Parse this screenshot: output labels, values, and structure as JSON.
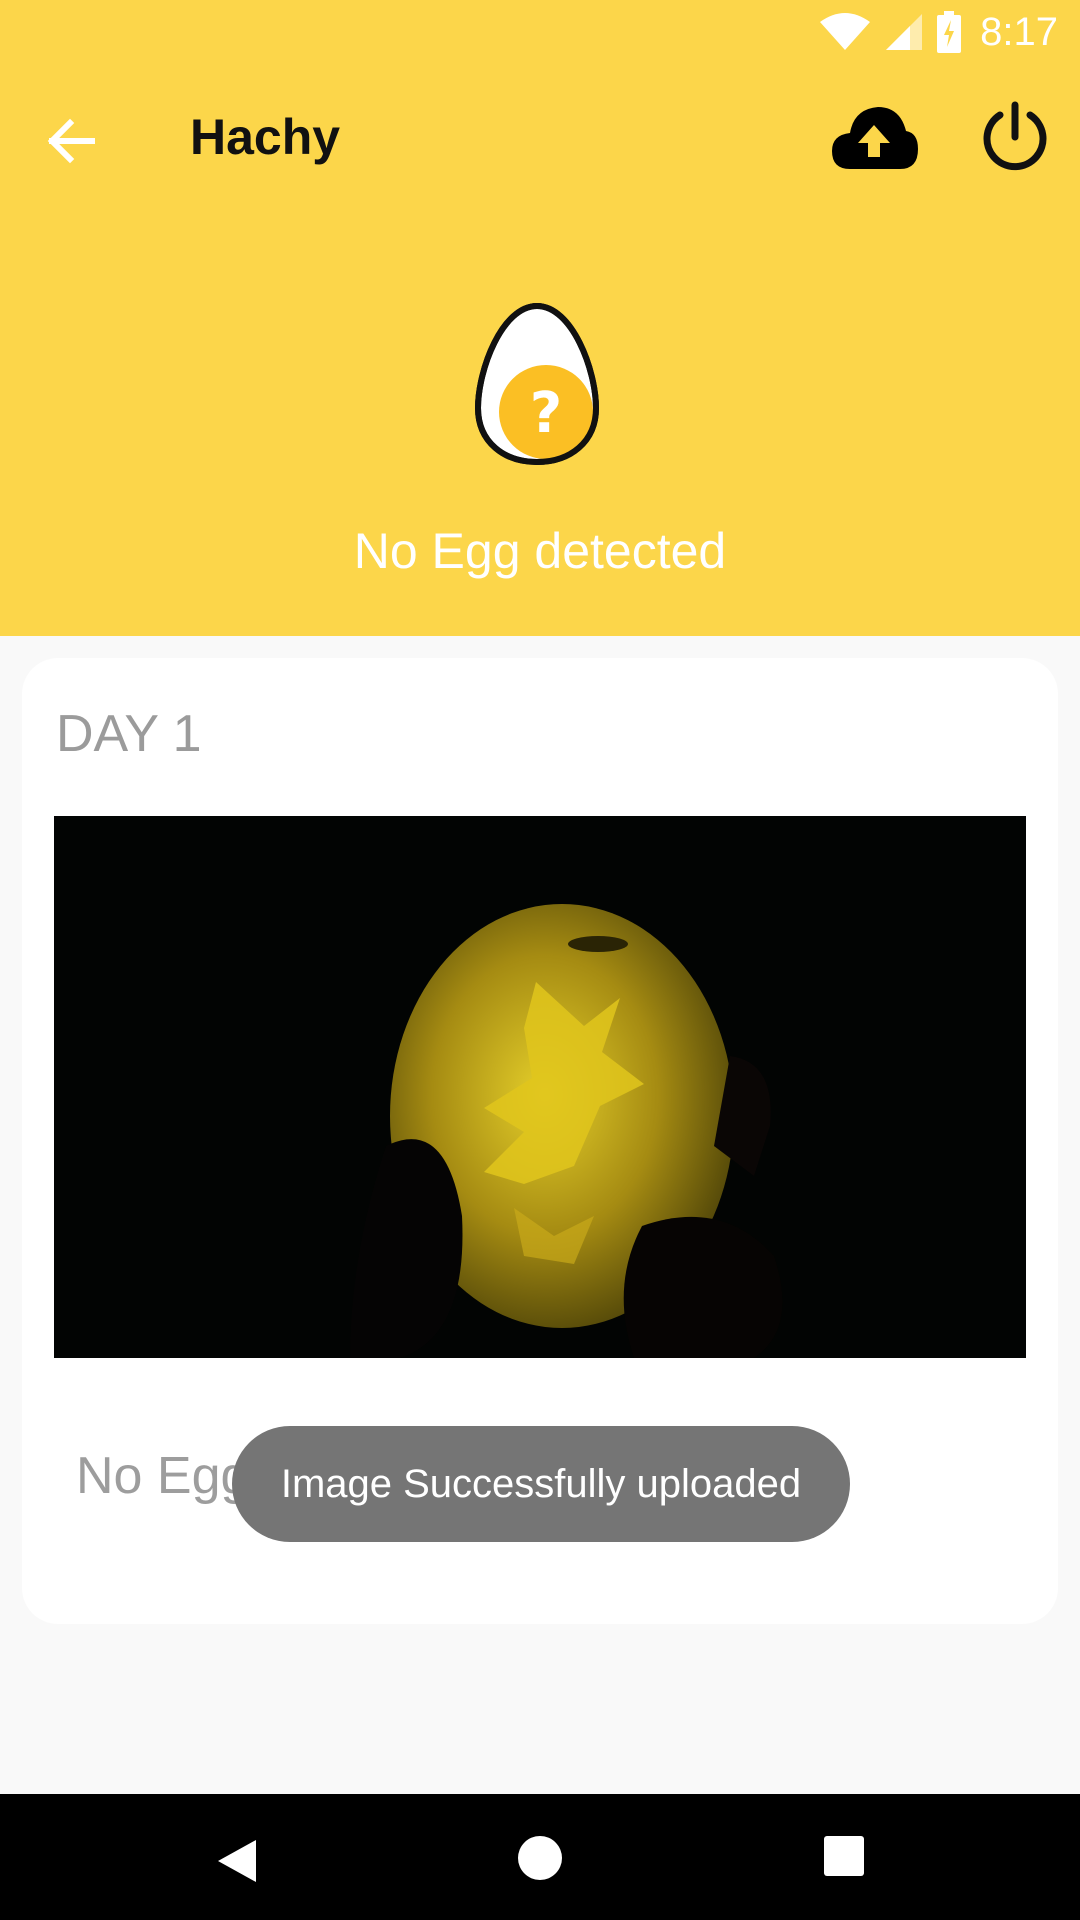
{
  "status_bar": {
    "time": "8:17",
    "icons": [
      "wifi-icon",
      "cellular-signal-icon",
      "battery-charging-icon"
    ]
  },
  "app_bar": {
    "title": "Hachy",
    "icons": [
      "back-arrow-icon",
      "cloud-upload-icon",
      "power-icon"
    ]
  },
  "header": {
    "status": "No Egg detected",
    "icon": "egg-question-icon"
  },
  "card": {
    "day_label": "DAY 1",
    "status": "No Egg detected"
  },
  "toast": {
    "message": "Image Successfully uploaded"
  },
  "colors": {
    "primary": "#fcd64a",
    "accent": "#fbbf24",
    "toast": "#757575"
  }
}
